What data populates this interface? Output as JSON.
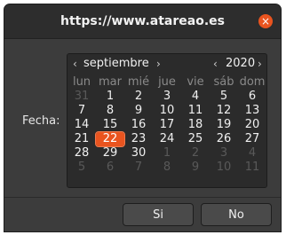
{
  "window": {
    "title": "https://www.atareao.es",
    "close_glyph": "×",
    "accent": "#e9541f"
  },
  "form": {
    "date_label": "Fecha:"
  },
  "calendar": {
    "prev_month": "‹",
    "month": "septiembre",
    "next_month": "›",
    "prev_year": "‹",
    "year": "2020",
    "next_year": "›",
    "day_names": [
      "lun",
      "mar",
      "mié",
      "jue",
      "vie",
      "sáb",
      "dom"
    ],
    "selected_day": 22,
    "weeks": [
      [
        {
          "d": "31",
          "o": true
        },
        {
          "d": "1"
        },
        {
          "d": "2"
        },
        {
          "d": "3"
        },
        {
          "d": "4"
        },
        {
          "d": "5"
        },
        {
          "d": "6"
        }
      ],
      [
        {
          "d": "7"
        },
        {
          "d": "8"
        },
        {
          "d": "9"
        },
        {
          "d": "10"
        },
        {
          "d": "11"
        },
        {
          "d": "12"
        },
        {
          "d": "13"
        }
      ],
      [
        {
          "d": "14"
        },
        {
          "d": "15"
        },
        {
          "d": "16"
        },
        {
          "d": "17"
        },
        {
          "d": "18"
        },
        {
          "d": "19"
        },
        {
          "d": "20"
        }
      ],
      [
        {
          "d": "21"
        },
        {
          "d": "22",
          "s": true
        },
        {
          "d": "23"
        },
        {
          "d": "24"
        },
        {
          "d": "25"
        },
        {
          "d": "26"
        },
        {
          "d": "27"
        }
      ],
      [
        {
          "d": "28"
        },
        {
          "d": "29"
        },
        {
          "d": "30"
        },
        {
          "d": "1",
          "o": true
        },
        {
          "d": "2",
          "o": true
        },
        {
          "d": "3",
          "o": true
        },
        {
          "d": "4",
          "o": true
        }
      ],
      [
        {
          "d": "5",
          "o": true
        },
        {
          "d": "6",
          "o": true
        },
        {
          "d": "7",
          "o": true
        },
        {
          "d": "8",
          "o": true
        },
        {
          "d": "9",
          "o": true
        },
        {
          "d": "10",
          "o": true
        },
        {
          "d": "11",
          "o": true
        }
      ]
    ]
  },
  "buttons": {
    "yes": "Si",
    "no": "No"
  }
}
